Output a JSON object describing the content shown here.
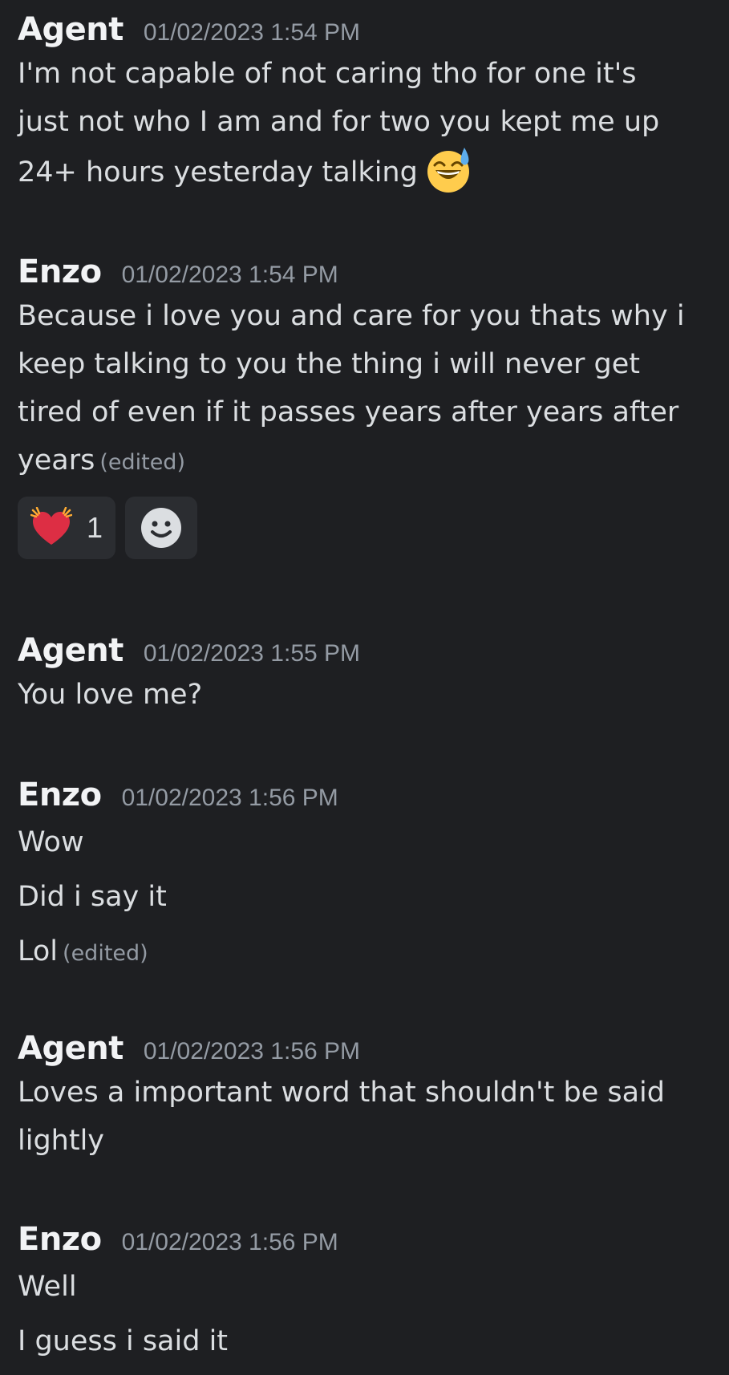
{
  "messages": [
    {
      "author": "Agent",
      "timestamp": "01/02/2023 1:54 PM",
      "lines": [
        "I'm not capable of not caring tho for one it's",
        "just not who I am and for two you kept me up",
        "24+ hours yesterday talking"
      ],
      "emoji": "sweat-smile-emoji"
    },
    {
      "author": "Enzo",
      "timestamp": "01/02/2023 1:54 PM",
      "lines": [
        "Because i love you and care for you thats why i",
        "keep talking to you the thing i will never get",
        "tired of even if it passes years after years after",
        "years"
      ],
      "edited": "(edited)",
      "reactions": [
        {
          "emoji": "heart-exclamation-emoji",
          "count": "1"
        },
        {
          "emoji": "add-reaction-icon"
        }
      ]
    },
    {
      "author": "Agent",
      "timestamp": "01/02/2023 1:55 PM",
      "lines": [
        "You love me?"
      ]
    },
    {
      "author": "Enzo",
      "timestamp": "01/02/2023 1:56 PM",
      "lines": [
        "Wow",
        "Did i say it",
        "Lol"
      ],
      "edited": "(edited)"
    },
    {
      "author": "Agent",
      "timestamp": "01/02/2023 1:56 PM",
      "lines": [
        "Loves a important word that shouldn't be said",
        "lightly"
      ]
    },
    {
      "author": "Enzo",
      "timestamp": "01/02/2023 1:56 PM",
      "lines": [
        "Well",
        "I guess i said it"
      ]
    }
  ],
  "colors": {
    "background": "#1e1f22",
    "text": "#dbdee1",
    "muted": "#949ba4",
    "reaction_bg": "#2b2d31"
  }
}
